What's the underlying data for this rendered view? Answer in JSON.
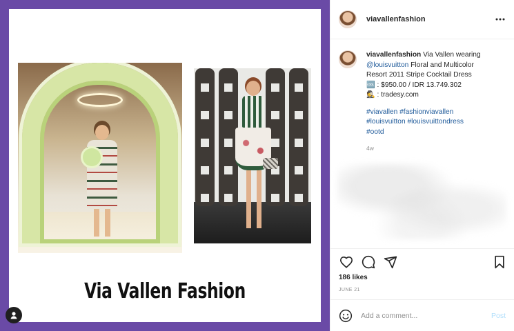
{
  "post": {
    "username": "viavallenfashion",
    "image_caption_art": "Via Vallen Fashion"
  },
  "caption": {
    "username": "viavallenfashion",
    "text_intro": " Via Vallen wearing",
    "mention": "@louisvuitton",
    "text_desc_1": " Floral and Multicolor",
    "text_desc_2": "Resort 2011 Stripe Cocktail Dress",
    "price_icon": "🆒",
    "price": " : $950.00 / IDR 13.749.302",
    "source_icon": "🕵",
    "source": " : tradesy.com",
    "hashtags_line1": "#viavallen #fashionviavallen",
    "hashtags_line2": "#louisvuitton #louisvuittondress",
    "hashtags_line3": "#ootd",
    "time_ago": "4w"
  },
  "actions": {
    "likes": "186 likes",
    "date": "JUNE 21"
  },
  "comment_box": {
    "placeholder": "Add a comment...",
    "post_label": "Post"
  },
  "colors": {
    "frame": "#6a4aa6",
    "link": "#1f5a9a",
    "post_button": "#b2dffc"
  },
  "icons": [
    "more-options-icon",
    "heart-icon",
    "comment-icon",
    "share-icon",
    "bookmark-icon",
    "emoji-icon",
    "user-tag-icon"
  ]
}
